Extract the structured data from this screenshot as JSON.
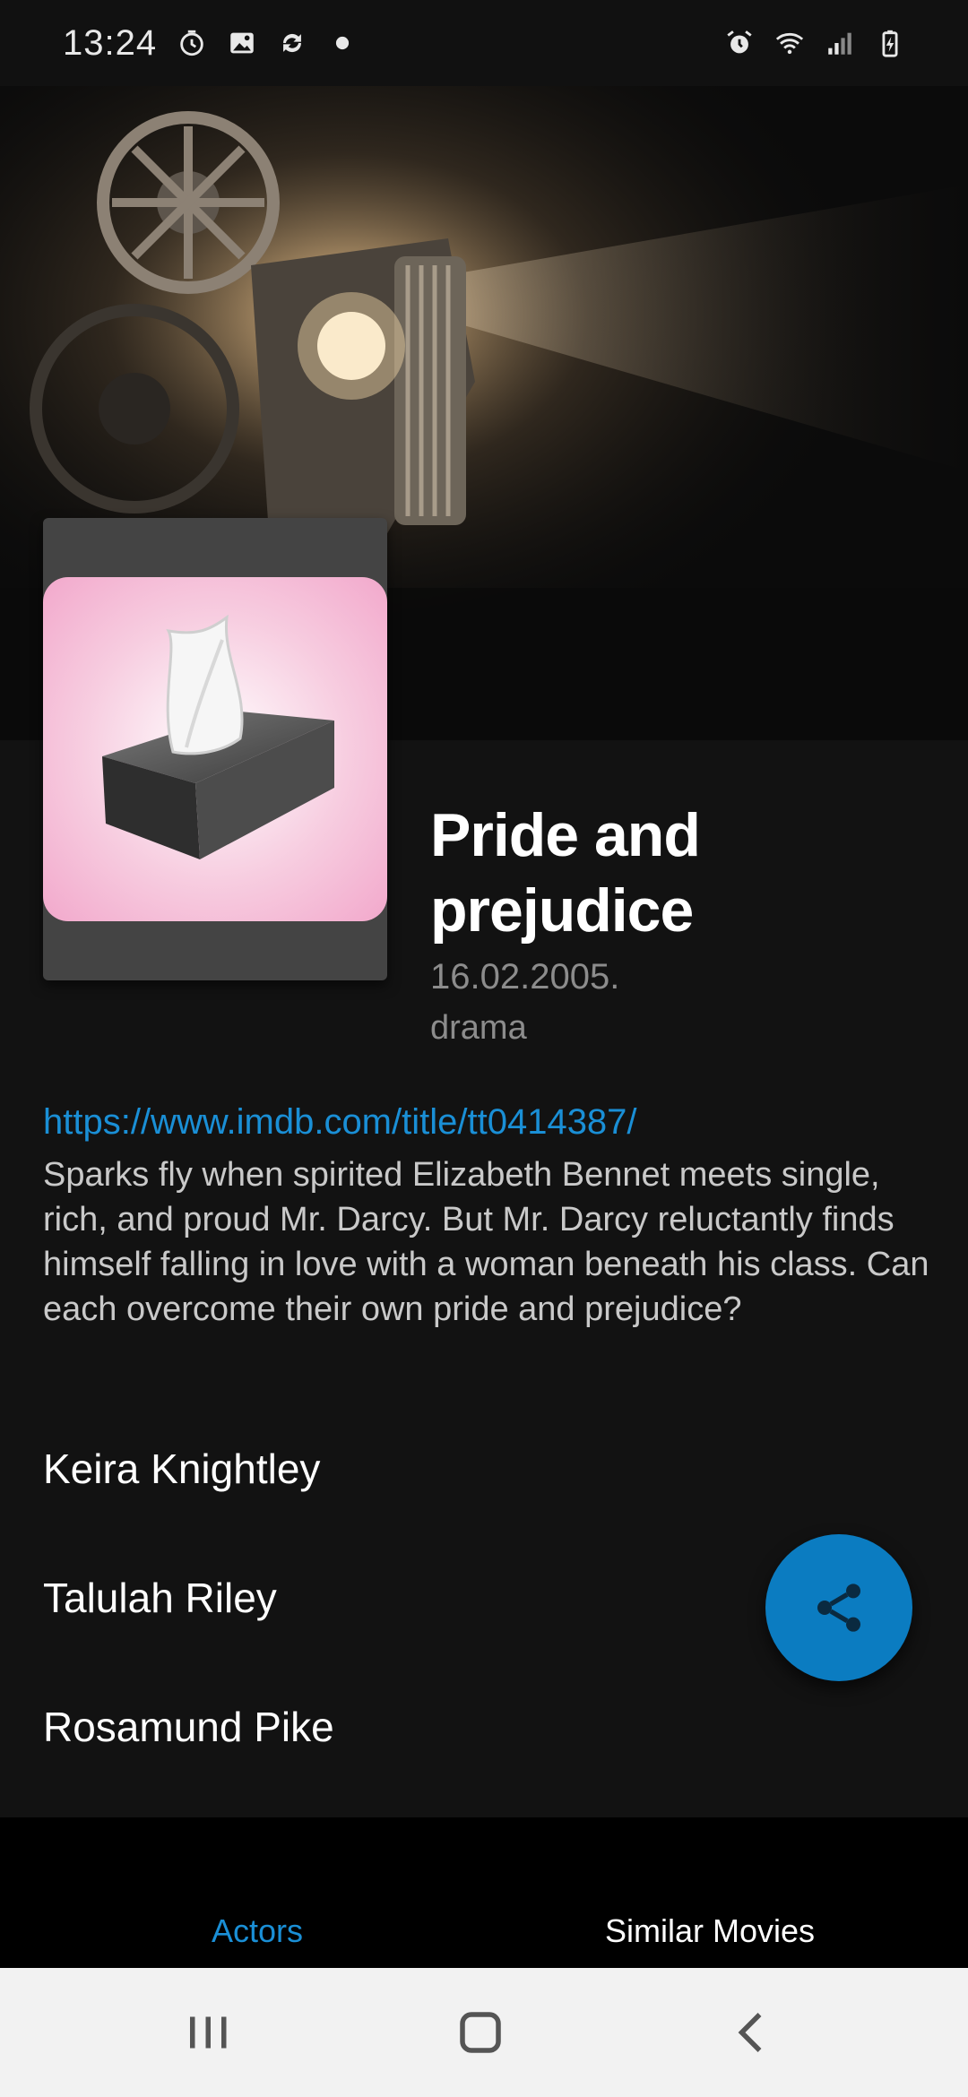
{
  "status_bar": {
    "time": "13:24",
    "left_icons": [
      "timer-icon",
      "image-icon",
      "sync-icon",
      "dot-icon"
    ],
    "right_icons": [
      "alarm-icon",
      "wifi-icon",
      "signal-icon",
      "battery-icon"
    ]
  },
  "movie": {
    "title": "Pride and prejudice",
    "release_date": "16.02.2005.",
    "genre": "drama",
    "imdb_url": "https://www.imdb.com/title/tt0414387/",
    "overview": "Sparks fly when spirited Elizabeth Bennet meets single, rich, and proud Mr. Darcy. But Mr. Darcy reluctantly finds himself falling in love with a woman beneath his class. Can each overcome their own pride and prejudice?"
  },
  "actors": [
    {
      "name": "Keira Knightley"
    },
    {
      "name": "Talulah Riley"
    },
    {
      "name": "Rosamund Pike"
    }
  ],
  "fab": {
    "icon": "share-icon"
  },
  "tabs": [
    {
      "label": "Actors",
      "active": true
    },
    {
      "label": "Similar Movies",
      "active": false
    }
  ],
  "nav_bar": {
    "buttons": [
      "recent-apps-icon",
      "home-icon",
      "back-icon"
    ]
  },
  "colors": {
    "accent": "#1a8fd6",
    "fab": "#0b7cc1",
    "background": "#121212",
    "poster_pink": "#f4b6d4"
  }
}
